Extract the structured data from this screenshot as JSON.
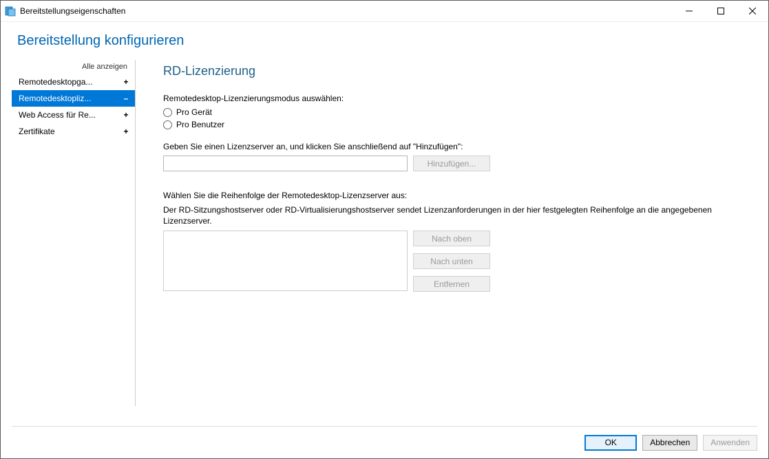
{
  "window": {
    "title": "Bereitstellungseigenschaften"
  },
  "header": {
    "title": "Bereitstellung konfigurieren"
  },
  "sidebar": {
    "show_all": "Alle anzeigen",
    "items": [
      {
        "label": "Remotedesktopga...",
        "expand": "+",
        "selected": false
      },
      {
        "label": "Remotedesktopliz...",
        "expand": "–",
        "selected": true
      },
      {
        "label": "Web Access für Re...",
        "expand": "+",
        "selected": false
      },
      {
        "label": "Zertifikate",
        "expand": "+",
        "selected": false
      }
    ]
  },
  "content": {
    "page_title": "RD-Lizenzierung",
    "mode_label": "Remotedesktop-Lizenzierungsmodus auswählen:",
    "radio_device": "Pro Gerät",
    "radio_user": "Pro Benutzer",
    "server_label": "Geben Sie einen Lizenzserver an, und klicken Sie anschließend auf \"Hinzufügen\":",
    "add_button": "Hinzufügen...",
    "order_label": "Wählen Sie die Reihenfolge der Remotedesktop-Lizenzserver aus:",
    "order_desc": "Der RD-Sitzungshostserver oder RD-Virtualisierungshostserver sendet Lizenzanforderungen in der hier festgelegten Reihenfolge an die angegebenen Lizenzserver.",
    "btn_up": "Nach oben",
    "btn_down": "Nach unten",
    "btn_remove": "Entfernen"
  },
  "footer": {
    "ok": "OK",
    "cancel": "Abbrechen",
    "apply": "Anwenden"
  }
}
